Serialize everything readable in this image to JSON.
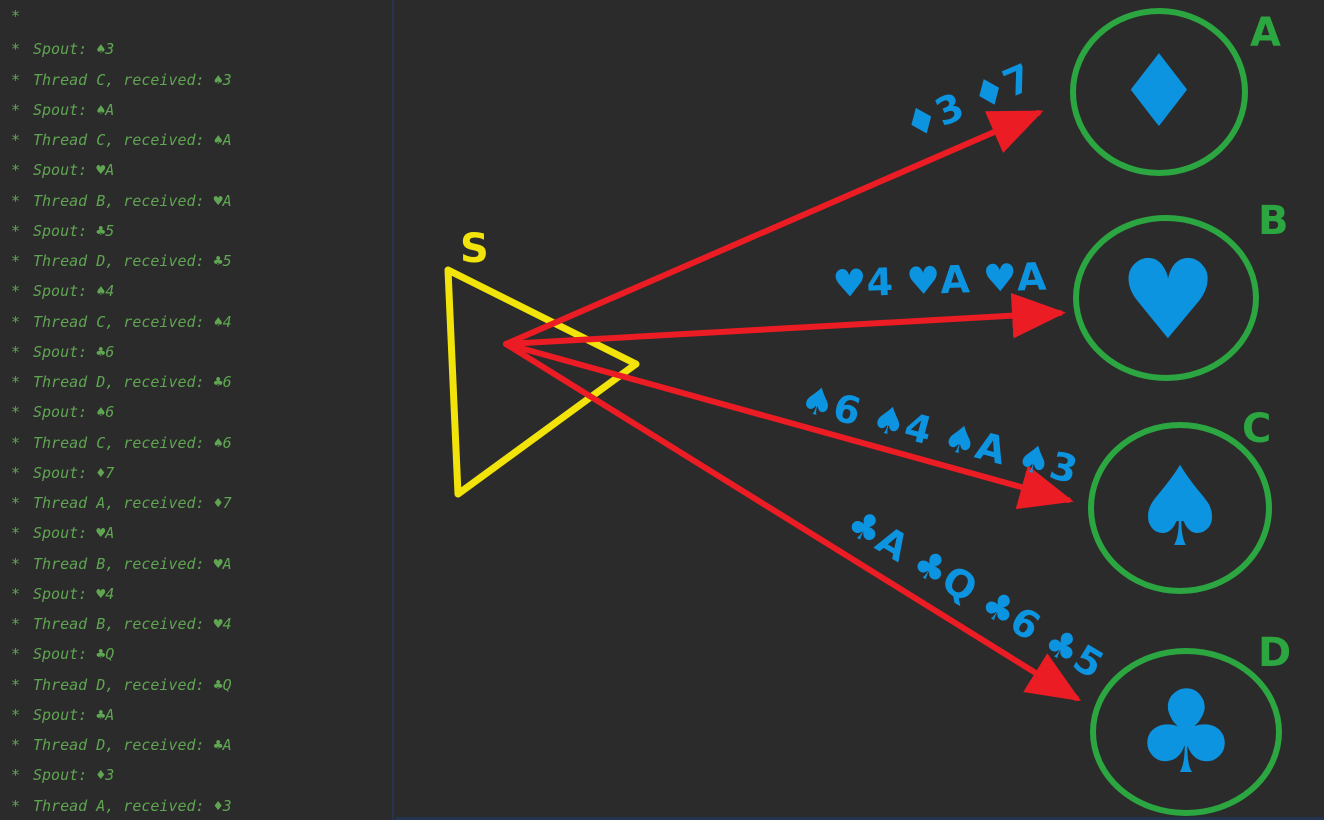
{
  "log": {
    "lines": [
      "",
      "Spout: ♠3",
      "Thread C, received: ♠3",
      "Spout: ♠A",
      "Thread C, received: ♠A",
      "Spout: ♥A",
      "Thread B, received: ♥A",
      "Spout: ♣5",
      "Thread D, received: ♣5",
      "Spout: ♠4",
      "Thread C, received: ♠4",
      "Spout: ♣6",
      "Thread D, received: ♣6",
      "Spout: ♠6",
      "Thread C, received: ♠6",
      "Spout: ♦7",
      "Thread A, received: ♦7",
      "Spout: ♥A",
      "Thread B, received: ♥A",
      "Spout: ♥4",
      "Thread B, received: ♥4",
      "Spout: ♣Q",
      "Thread D, received: ♣Q",
      "Spout: ♣A",
      "Thread D, received: ♣A",
      "Spout: ♦3",
      "Thread A, received: ♦3"
    ],
    "bullet": "*"
  },
  "diagram": {
    "spout": {
      "label": "S",
      "color": "#f2e40a"
    },
    "nodes": [
      {
        "id": "A",
        "label": "A",
        "suit": "♦",
        "suit_name": "diamond-icon"
      },
      {
        "id": "B",
        "label": "B",
        "suit": "♥",
        "suit_name": "heart-icon"
      },
      {
        "id": "C",
        "label": "C",
        "suit": "♠",
        "suit_name": "spade-icon"
      },
      {
        "id": "D",
        "label": "D",
        "suit": "♣",
        "suit_name": "club-icon"
      }
    ],
    "edges": [
      {
        "to": "A",
        "label": "♦3 ♦7"
      },
      {
        "to": "B",
        "label": "♥4 ♥A ♥A"
      },
      {
        "to": "C",
        "label": "♠6 ♠4 ♠A ♠3"
      },
      {
        "to": "D",
        "label": "♣A ♣Q ♣6 ♣5"
      }
    ],
    "colors": {
      "node_ring": "#2ba640",
      "suit": "#0d94e0",
      "edge": "#ec1c24",
      "spout": "#f2e40a",
      "log_text": "#5fa552",
      "background": "#2b2b2b"
    }
  }
}
